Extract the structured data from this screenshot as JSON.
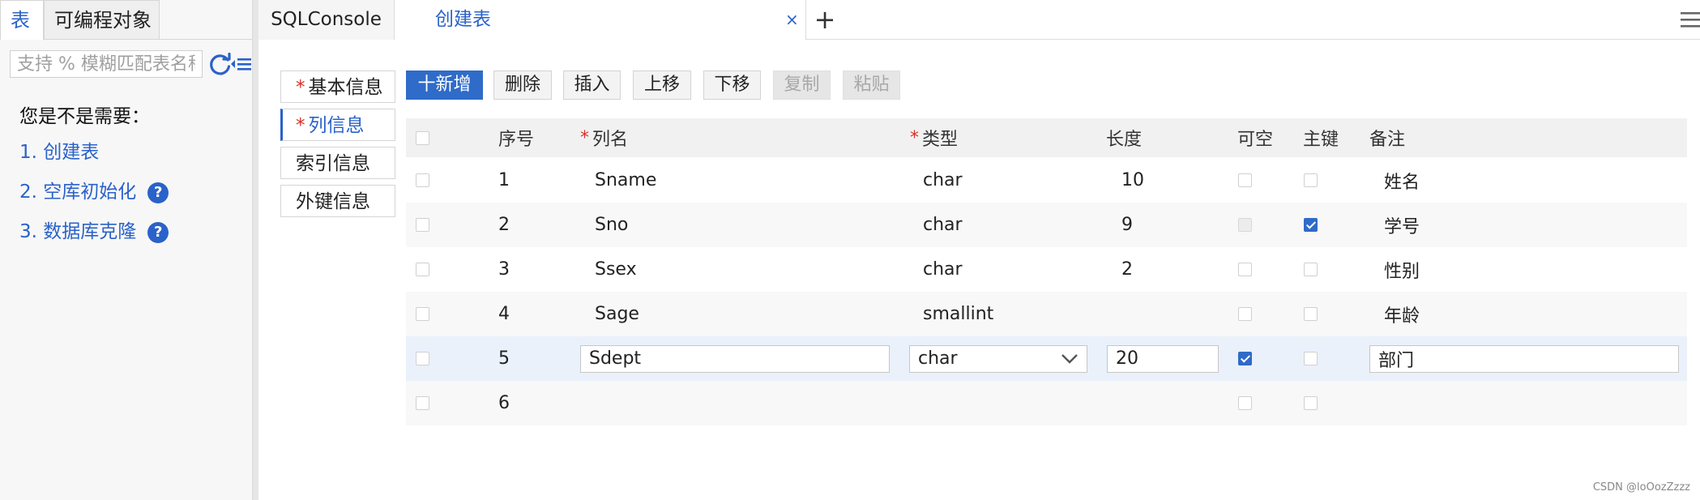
{
  "left_panel": {
    "tabs": [
      "表",
      "可编程对象"
    ],
    "search_placeholder": "支持 % 模糊匹配表名称",
    "need_title": "您是不是需要：",
    "suggestions": [
      "1.  创建表",
      "2.  空库初始化",
      "3.  数据库克隆"
    ],
    "help_glyph": "?"
  },
  "tabbar": {
    "tabs": [
      "SQLConsole",
      "创建表"
    ],
    "close_glyph": "×",
    "add_glyph": "+"
  },
  "sections": {
    "required_mark": "*",
    "basic": "基本信息",
    "columns": "列信息",
    "index": "索引信息",
    "foreign": "外键信息"
  },
  "toolbar": {
    "add": "十新增",
    "delete": "删除",
    "insert": "插入",
    "up": "上移",
    "down": "下移",
    "copy": "复制",
    "paste": "粘贴"
  },
  "grid": {
    "headers": {
      "seq": "序号",
      "name": "列名",
      "type": "类型",
      "length": "长度",
      "nullable": "可空",
      "primary": "主键",
      "comment": "备注"
    },
    "rows": [
      {
        "seq": "1",
        "name": "Sname",
        "type": "char",
        "length": "10",
        "nullable": false,
        "primary": false,
        "comment": "姓名"
      },
      {
        "seq": "2",
        "name": "Sno",
        "type": "char",
        "length": "9",
        "nullable": false,
        "primary": true,
        "comment": "学号"
      },
      {
        "seq": "3",
        "name": "Ssex",
        "type": "char",
        "length": "2",
        "nullable": false,
        "primary": false,
        "comment": "性别"
      },
      {
        "seq": "4",
        "name": "Sage",
        "type": "smallint",
        "length": "",
        "nullable": false,
        "primary": false,
        "comment": "年龄"
      },
      {
        "seq": "5",
        "name": "Sdept",
        "type": "char",
        "length": "20",
        "nullable": true,
        "primary": false,
        "comment": "部门"
      },
      {
        "seq": "6",
        "name": "",
        "type": "",
        "length": "",
        "nullable": false,
        "primary": false,
        "comment": ""
      }
    ]
  },
  "watermark": "CSDN @loOozZzzz",
  "colors": {
    "accent": "#2f6bc8",
    "required": "#d93025",
    "selected_row": "#eaf1fb"
  }
}
